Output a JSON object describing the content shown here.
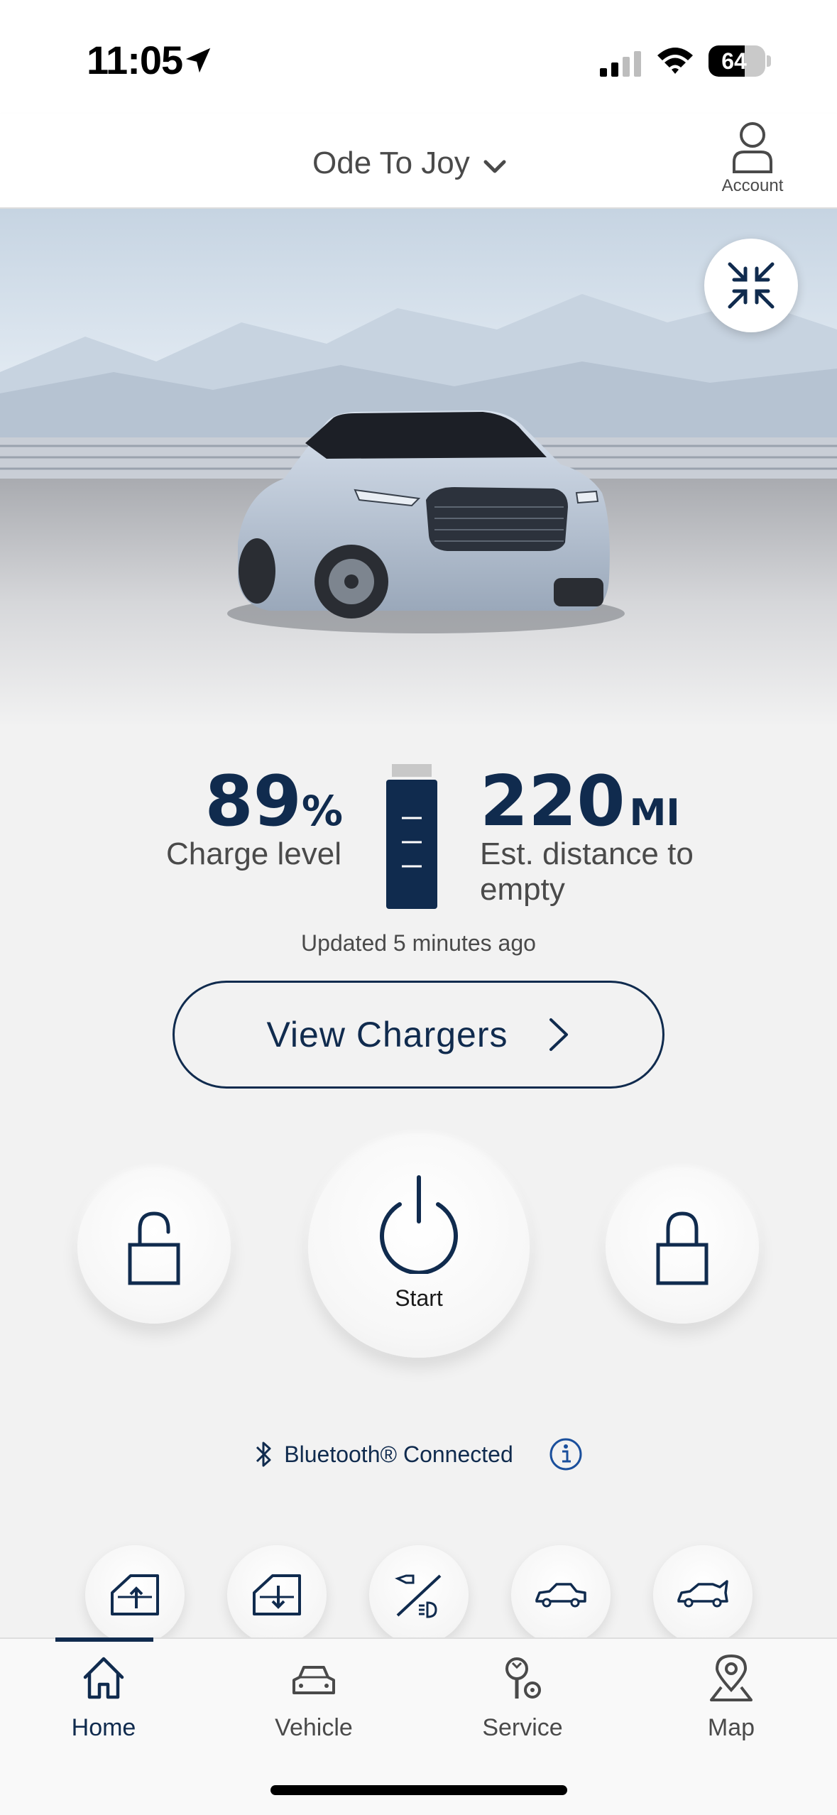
{
  "status_bar": {
    "time": "11:05",
    "battery_percent": "64",
    "battery_level": 0.64
  },
  "header": {
    "vehicle_name": "Ode To Joy",
    "account_label": "Account"
  },
  "vehicle_status": {
    "charge_value": "89",
    "charge_unit": "%",
    "charge_label": "Charge level",
    "range_value": "220",
    "range_unit": "MI",
    "range_label": "Est. distance to empty",
    "updated_text": "Updated 5 minutes ago"
  },
  "actions": {
    "view_chargers_label": "View Chargers",
    "start_label": "Start"
  },
  "bluetooth": {
    "status_text": "Bluetooth® Connected"
  },
  "quick_actions": [
    {
      "icon": "window-up-icon"
    },
    {
      "icon": "window-down-icon"
    },
    {
      "icon": "horn-lights-icon"
    },
    {
      "icon": "trunk-icon"
    },
    {
      "icon": "frunk-icon"
    }
  ],
  "tabs": [
    {
      "label": "Home",
      "icon": "home-icon",
      "active": true
    },
    {
      "label": "Vehicle",
      "icon": "car-icon",
      "active": false
    },
    {
      "label": "Service",
      "icon": "service-icon",
      "active": false
    },
    {
      "label": "Map",
      "icon": "map-pin-icon",
      "active": false
    }
  ],
  "colors": {
    "brand_navy": "#102b4e",
    "text_gray": "#4a4a4a",
    "background": "#f2f2f2"
  }
}
